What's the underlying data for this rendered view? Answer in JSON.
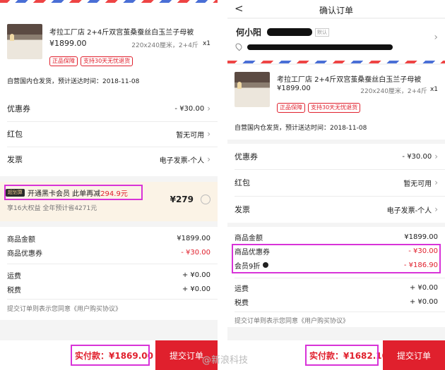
{
  "left": {
    "product": {
      "title": "考拉工厂店 2+4斤双宫茧桑蚕丝白玉兰子母被",
      "price": "¥1899.00",
      "spec": "220x240厘米，2+4斤",
      "qty": "x1",
      "tags": [
        "正品保障",
        "支持30天无忧退货"
      ]
    },
    "shipping": "自营国内仓发货，预计送达时间：2018-11-08",
    "coupon": {
      "label": "优惠券",
      "value": "- ¥30.00"
    },
    "redpacket": {
      "label": "红包",
      "value": "暂无可用"
    },
    "invoice": {
      "label": "发票",
      "value": "电子发票-个人"
    },
    "membership": {
      "badge": "超划算",
      "text": "开通黑卡会员 此单再减",
      "discount": "294.9元",
      "price": "¥279",
      "sub": "享16大权益 全年预计省4271元"
    },
    "summary": [
      {
        "label": "商品金额",
        "value": "¥1899.00",
        "red": false
      },
      {
        "label": "商品优惠券",
        "value": "- ¥30.00",
        "red": true
      }
    ],
    "fees": [
      {
        "label": "运费",
        "value": "+ ¥0.00"
      },
      {
        "label": "税费",
        "value": "+ ¥0.00"
      }
    ],
    "agreement": "提交订单则表示您同意《用户购买协议》",
    "total": "实付款：¥1869.00",
    "submit": "提交订单"
  },
  "right": {
    "nav_title": "确认订单",
    "back": "<",
    "user_name": "何小阳",
    "default_tag": "默认",
    "product": {
      "title": "考拉工厂店 2+4斤双宫茧桑蚕丝白玉兰子母被",
      "price": "¥1899.00",
      "spec": "220x240厘米，2+4斤",
      "qty": "x1",
      "tags": [
        "正品保障",
        "支持30天无忧退货"
      ]
    },
    "shipping": "自营国内仓发货，预计送达时间：2018-11-08",
    "coupon": {
      "label": "优惠券",
      "value": "- ¥30.00"
    },
    "redpacket": {
      "label": "红包",
      "value": "暂无可用"
    },
    "invoice": {
      "label": "发票",
      "value": "电子发票-个人"
    },
    "summary": [
      {
        "label": "商品金额",
        "value": "¥1899.00"
      },
      {
        "label": "商品优惠券",
        "value": "- ¥30.00"
      },
      {
        "label": "会员9折",
        "value": "- ¥186.90"
      }
    ],
    "fees": [
      {
        "label": "运费",
        "value": "+ ¥0.00"
      },
      {
        "label": "税费",
        "value": "+ ¥0.00"
      }
    ],
    "agreement": "提交订单则表示您同意《用户购买协议》",
    "total": "实付款：¥1682.10",
    "submit": "提交订单"
  },
  "watermark": "@新浪科技",
  "colors": {
    "accent": "#e0202d",
    "highlight": "#d833d8"
  }
}
